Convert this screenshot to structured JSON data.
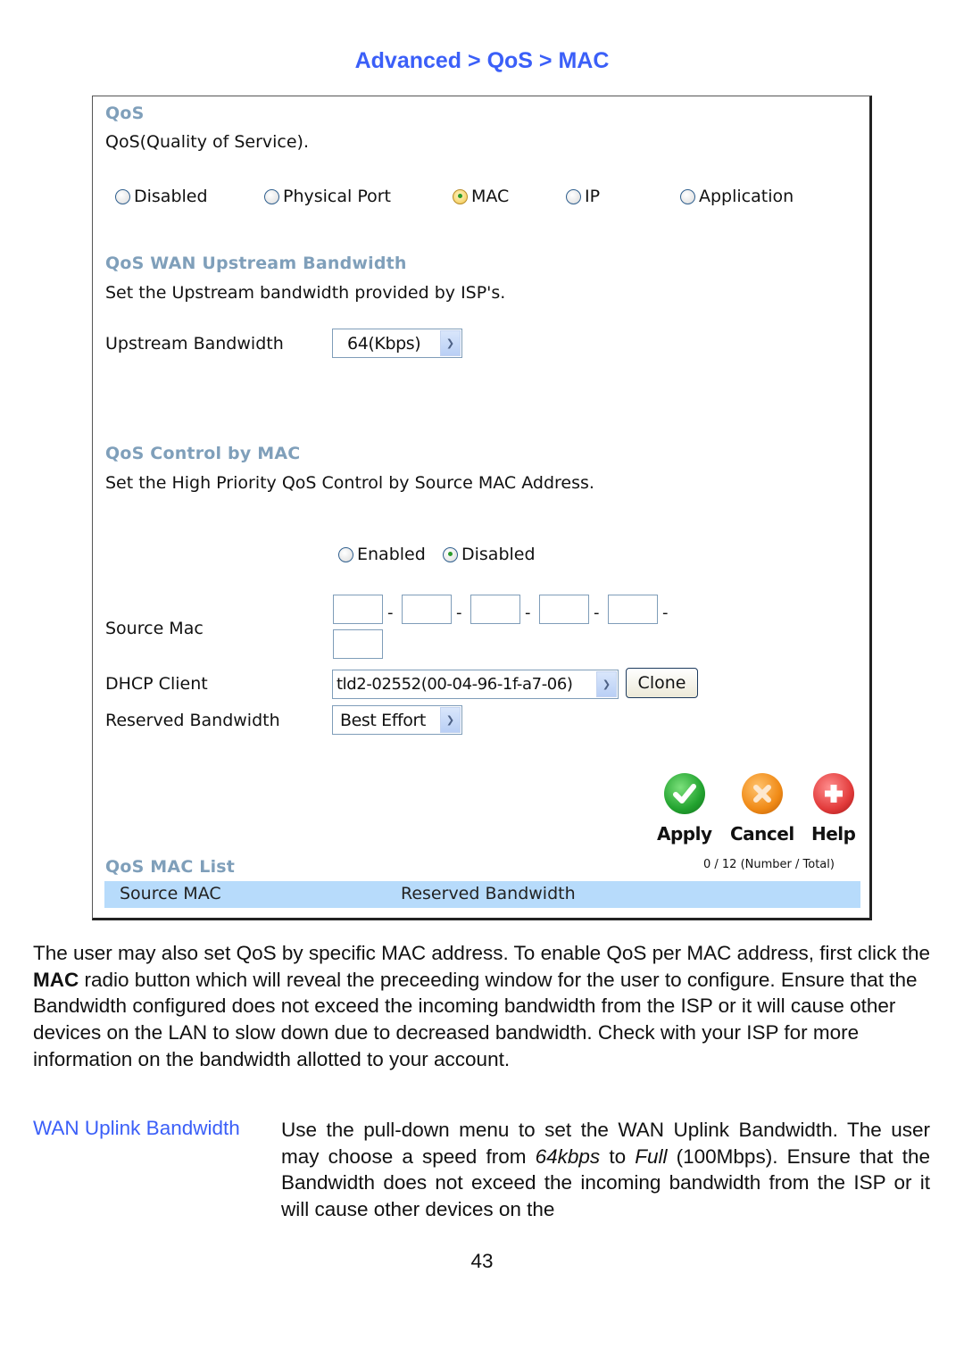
{
  "page_title": "Advanced > QoS > MAC",
  "qos": {
    "title": "QoS",
    "description": "QoS(Quality of Service).",
    "modes": [
      {
        "label": "Disabled",
        "checked": false
      },
      {
        "label": "Physical Port",
        "checked": false
      },
      {
        "label": "MAC",
        "checked": true
      },
      {
        "label": "IP",
        "checked": false
      },
      {
        "label": "Application",
        "checked": false
      }
    ]
  },
  "upstream": {
    "title": "QoS WAN Upstream Bandwidth",
    "description": "Set the Upstream bandwidth provided by ISP's.",
    "field_label": "Upstream Bandwidth",
    "selected": "64(Kbps)"
  },
  "control": {
    "title": "QoS Control by MAC",
    "description": "Set the High Priority QoS Control by Source MAC Address.",
    "enable_options": [
      {
        "label": "Enabled",
        "checked": false
      },
      {
        "label": "Disabled",
        "checked": true
      }
    ],
    "source_mac_label": "Source Mac",
    "mac_octets": [
      "",
      "",
      "",
      "",
      "",
      ""
    ],
    "mac_separator": "-",
    "dhcp_client_label": "DHCP Client",
    "dhcp_client_selected": "tld2-02552(00-04-96-1f-a7-06)",
    "clone_label": "Clone",
    "reserved_bandwidth_label": "Reserved Bandwidth",
    "reserved_bandwidth_selected": "Best Effort"
  },
  "actions": {
    "apply": "Apply",
    "cancel": "Cancel",
    "help": "Help"
  },
  "mac_list": {
    "title": "QoS MAC List",
    "count": "0 / 12 (Number / Total)",
    "columns": [
      "Source MAC",
      "Reserved Bandwidth"
    ],
    "rows": []
  },
  "document": {
    "paragraph": {
      "part1": "The user may also set QoS by specific MAC address. To enable QoS per MAC address, first click the ",
      "bold": "MAC",
      "part2": " radio button which will reveal the preceeding window for the user to configure. Ensure that the Bandwidth configured does not exceed the incoming bandwidth from the ISP or it will cause other devices on the LAN to slow down due to decreased bandwidth. Check with your ISP for more information on the bandwidth allotted to your account."
    },
    "definition": {
      "term": "WAN Uplink Bandwidth",
      "desc_part1": "Use the pull-down menu to set the WAN Uplink Bandwidth. The user may choose a speed from ",
      "desc_italic1": "64kbps",
      "desc_part2": " to ",
      "desc_italic2": "Full",
      "desc_part3": " (100Mbps). Ensure that the Bandwidth does not exceed the incoming bandwidth from the ISP or it will cause other devices on the"
    },
    "page_number": "43"
  },
  "colors": {
    "heading_blue": "#3b5ff8",
    "section_title": "#7f9fba",
    "list_header_bg": "#b7dbfb"
  }
}
